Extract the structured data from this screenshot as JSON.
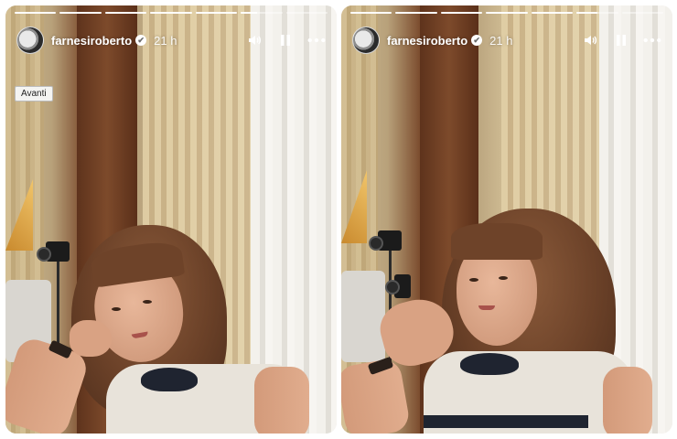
{
  "stories": [
    {
      "username": "farnesiroberto",
      "time": "21 h",
      "verified_glyph": "✔",
      "progress": [
        1,
        1,
        1,
        1,
        1,
        0.4,
        0
      ],
      "tooltip": "Avanti"
    },
    {
      "username": "farnesiroberto",
      "time": "21 h",
      "verified_glyph": "✔",
      "progress": [
        1,
        1,
        1,
        1,
        1,
        0.5,
        0
      ]
    }
  ],
  "icons": {
    "volume": "volume-icon",
    "pause": "pause-icon",
    "more": "more-icon",
    "verified": "verified-badge-icon"
  },
  "colors": {
    "overlay_text": "#ffffff",
    "progress_track": "rgba(255,255,255,0.45)",
    "progress_fill": "#ffffff"
  }
}
